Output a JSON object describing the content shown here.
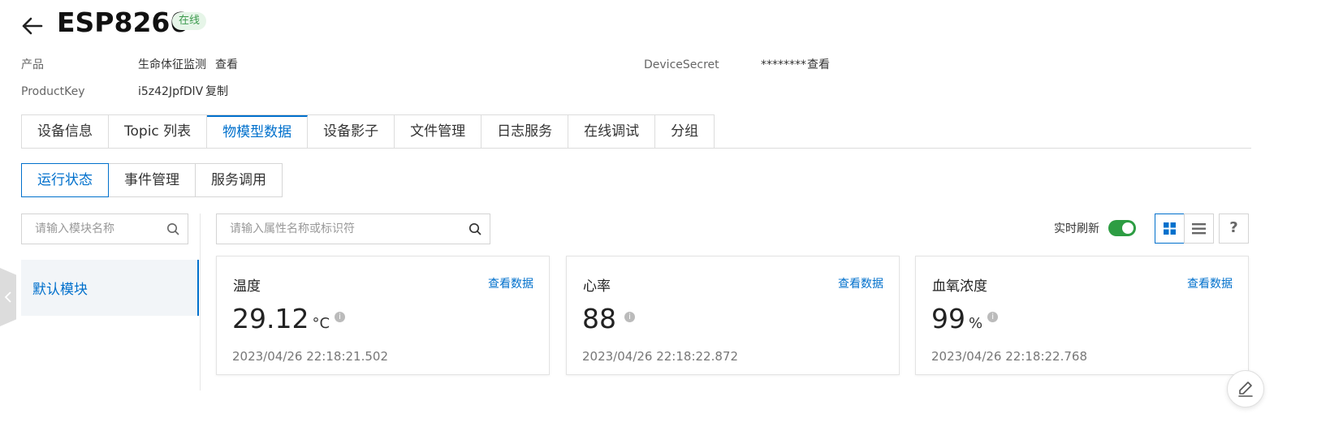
{
  "header": {
    "title": "ESP8266",
    "status": "在线"
  },
  "meta": {
    "product_label": "产品",
    "product_value": "生命体征监测",
    "product_link": "查看",
    "productkey_label": "ProductKey",
    "productkey_value": "i5z42JpfDlV",
    "productkey_link": "复制",
    "secret_label": "DeviceSecret",
    "secret_value": "********",
    "secret_link": "查看"
  },
  "tabs": [
    {
      "label": "设备信息"
    },
    {
      "label": "Topic 列表"
    },
    {
      "label": "物模型数据"
    },
    {
      "label": "设备影子"
    },
    {
      "label": "文件管理"
    },
    {
      "label": "日志服务"
    },
    {
      "label": "在线调试"
    },
    {
      "label": "分组"
    }
  ],
  "subtabs": [
    {
      "label": "运行状态"
    },
    {
      "label": "事件管理"
    },
    {
      "label": "服务调用"
    }
  ],
  "module_search": {
    "placeholder": "请输入模块名称"
  },
  "property_search": {
    "placeholder": "请输入属性名称或标识符"
  },
  "modules": [
    {
      "label": "默认模块"
    }
  ],
  "toolbar": {
    "realtime_label": "实时刷新",
    "realtime_on": true,
    "help": "?"
  },
  "cards": [
    {
      "title": "温度",
      "link": "查看数据",
      "value": "29.12",
      "unit": "°C",
      "time": "2023/04/26 22:18:21.502"
    },
    {
      "title": "心率",
      "link": "查看数据",
      "value": "88",
      "unit": "",
      "time": "2023/04/26 22:18:22.872"
    },
    {
      "title": "血氧浓度",
      "link": "查看数据",
      "value": "99",
      "unit": "%",
      "time": "2023/04/26 22:18:22.768"
    }
  ],
  "colors": {
    "accent": "#0070cc",
    "online": "#3d9a4e",
    "toggle_on": "#2d9d43"
  }
}
